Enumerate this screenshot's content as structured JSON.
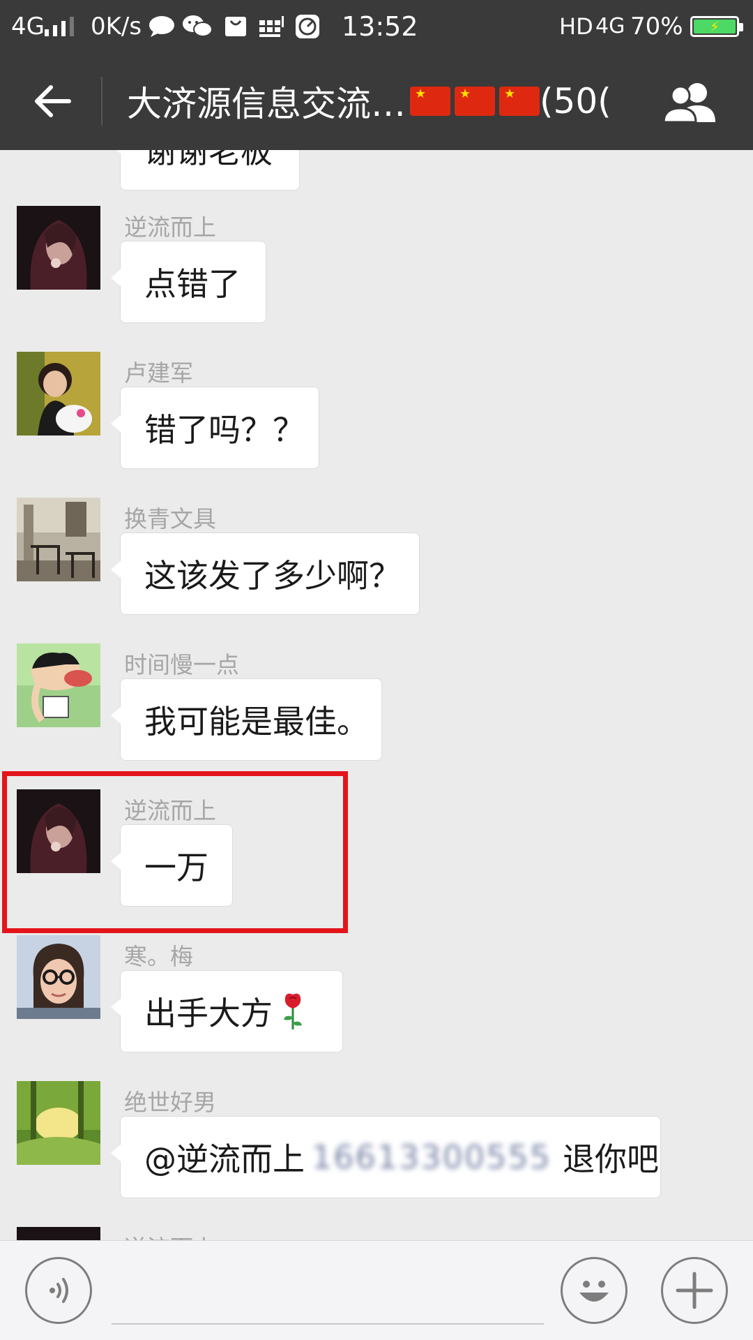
{
  "status_bar": {
    "network": "4G",
    "speed": "0K/s",
    "time": "13:52",
    "hd": "HD",
    "network2": "4G",
    "battery": "70%",
    "icons": [
      "signal-bars-icon",
      "chat-bubble-icon",
      "wechat-icon",
      "bag-icon",
      "grid-icon",
      "gauge-icon",
      "battery-icon"
    ]
  },
  "header": {
    "title": "大济源信息交流…",
    "title_suffix": "(50(",
    "back_icon": "arrow-left-icon",
    "members_icon": "group-members-icon",
    "flag_icon": "china-flag-icon"
  },
  "messages": [
    {
      "sender": "",
      "text": "谢谢老板"
    },
    {
      "sender": "逆流而上",
      "text": "点错了"
    },
    {
      "sender": "卢建军",
      "text": "错了吗？？"
    },
    {
      "sender": "换青文具",
      "text": "这该发了多少啊？"
    },
    {
      "sender": "时间慢一点",
      "text": "我可能是最佳。"
    },
    {
      "sender": "逆流而上",
      "text": "一万"
    },
    {
      "sender": "寒。梅",
      "text": "出手大方"
    },
    {
      "sender": "绝世好男",
      "text_prefix": "@逆流而上",
      "phone": "16613300555",
      "text_suffix": "退你吧"
    },
    {
      "sender": "逆流而上",
      "text": ""
    }
  ],
  "colors": {
    "bar_background": "#3a3a3a",
    "chat_background": "#ebebeb",
    "highlight": "#e3151a"
  },
  "input": {
    "placeholder": "",
    "value": ""
  }
}
